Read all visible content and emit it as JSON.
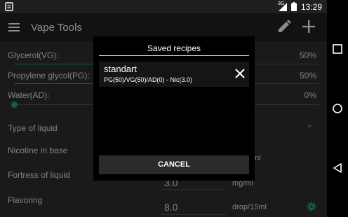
{
  "status_bar": {
    "network": "3G",
    "time": "13:29"
  },
  "toolbar": {
    "title": "Vape Tools",
    "menu_icon": "menu-icon",
    "edit_icon": "pencil-icon",
    "add_icon": "plus-icon"
  },
  "form": {
    "glycerol_label": "Glycerol(VG):",
    "glycerol_pct": "50%",
    "glycerol_level": 0.5,
    "pg_label": "Propylene glycol(PG):",
    "pg_pct": "50%",
    "pg_level": 0.5,
    "water_label": "Water(AD):",
    "water_pct": "0%",
    "water_level": 0,
    "liquid_type_label": "Type of liquid",
    "nicotine_base_label": "Nicotine in base",
    "nicotine_base_unit_fragment": "nl",
    "fortress_label": "Fortress of liquid",
    "fortress_value": "3.0",
    "fortress_unit": "mg/ml",
    "flavoring_label": "Flavoring",
    "flavoring_value": "8.0",
    "flavoring_unit": "drop/15ml"
  },
  "dialog": {
    "title": "Saved recipes",
    "recipes": [
      {
        "name": "standart",
        "summary": "PG(50)/VG(50)/AD(0) - Nic(3.0)"
      }
    ],
    "cancel_label": "CANCEL"
  },
  "colors": {
    "accent": "#26a69a",
    "background": "#303030",
    "toolbar": "#212121",
    "dialog": "#000000"
  }
}
